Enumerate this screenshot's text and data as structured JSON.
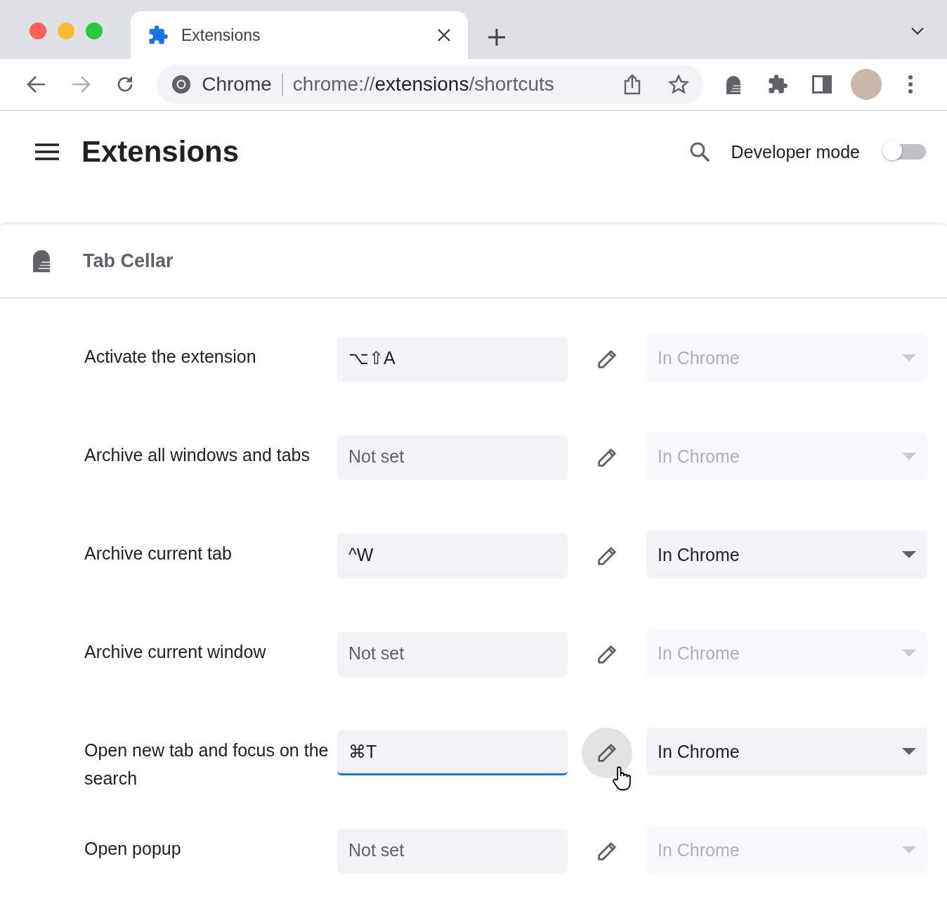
{
  "window": {
    "tab_title": "Extensions",
    "address_chip": "Chrome",
    "url": {
      "scheme": "chrome://",
      "host": "extensions",
      "path": "/shortcuts"
    }
  },
  "header": {
    "title": "Extensions",
    "developer_mode": {
      "label": "Developer mode",
      "on": false
    }
  },
  "extension": {
    "name": "Tab Cellar"
  },
  "shortcuts": [
    {
      "label": "Activate the extension",
      "value": "⌥⇧A",
      "focused": false,
      "scope": "In Chrome",
      "scope_disabled": true
    },
    {
      "label": "Archive all windows and tabs",
      "placeholder": "Not set",
      "focused": false,
      "scope": "In Chrome",
      "scope_disabled": true
    },
    {
      "label": "Archive current tab",
      "value": "^W",
      "focused": false,
      "scope": "In Chrome",
      "scope_disabled": false
    },
    {
      "label": "Archive current window",
      "placeholder": "Not set",
      "focused": false,
      "scope": "In Chrome",
      "scope_disabled": true
    },
    {
      "label": "Open new tab and focus on the search",
      "value": "⌘T",
      "focused": true,
      "scope": "In Chrome",
      "scope_disabled": false
    },
    {
      "label": "Open popup",
      "placeholder": "Not set",
      "focused": false,
      "scope": "In Chrome",
      "scope_disabled": true
    }
  ]
}
